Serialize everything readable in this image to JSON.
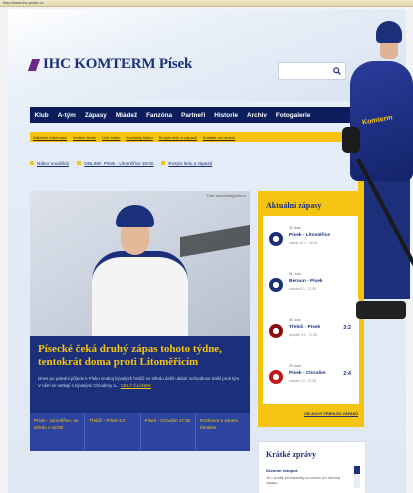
{
  "window": {
    "title": "http://www.ihc-pisek.cz"
  },
  "brand": {
    "name": "IHC KOMTERM Písek",
    "accent": "#1b2f7a",
    "yellow": "#f5c410"
  },
  "search": {
    "placeholder": "",
    "icon": "search-icon"
  },
  "nav": {
    "items": [
      "Klub",
      "A-tým",
      "Zápasy",
      "Mládež",
      "Fanzóna",
      "Partneři",
      "Historie",
      "Archiv",
      "Fotogalerie"
    ]
  },
  "subnav": {
    "items": [
      "Základní informace",
      "Vedení klubu",
      "Lidé klubu",
      "Kontakty klubu",
      "Rozpis ledu a zápasů",
      "Kontakt na vedení"
    ]
  },
  "ticker": {
    "items": [
      "Nábor nováčků!",
      "ONLINE: Písek - Litoměřice 18:00",
      "Rozpis ledu a zápasů"
    ]
  },
  "feature": {
    "credit": "Foto: www.hokejpisek.cz",
    "headline": "Písecké čeká druhý zápas tohoto týdne, tentokrát doma proti Litoměřicím",
    "lead": "Dnes po poledni přijede k Písku souboj bývalých hráčů ve středu další utkání rozhodnout další proti tým. V něm se setkají s bývalými Chrudimy a...",
    "more": "CELÝ ČLÁNEK",
    "bottom": [
      "Písek - Litoměřice, ve středu v 18:00",
      "Třebíč - Písek 3:2",
      "Písek - Chrudim 17:30",
      "Rozhovor s Janem Šimkem"
    ]
  },
  "matches": {
    "title": "Aktuální zápasy",
    "items": [
      {
        "tag": "32. kolo",
        "teams": "Písek - Litoměřice",
        "when": "středa 12.1., 18:00",
        "score": "",
        "badge": "#1b2f7a"
      },
      {
        "tag": "31. kolo",
        "teams": "Beroun - Písek",
        "when": "sobota 8.1., 17:30",
        "score": "",
        "badge": "#1b2f7a"
      },
      {
        "tag": "30. kolo",
        "teams": "Třebíč - Písek",
        "when": "pondělí 3.1., 17:30",
        "score": "3:2",
        "badge": "#8a1010"
      },
      {
        "tag": "29. kolo",
        "teams": "Písek - Chrudim",
        "when": "sobota 1.1., 17:30",
        "score": "2:4",
        "badge": "#c01818"
      }
    ],
    "all_label": "CELKOVÝ PŘEHLED ZÁPASŮ"
  },
  "news": {
    "title": "Krátké zprávy",
    "item_title": "Sezónní vstupné",
    "item_desc": "Již v prodeji permanentky na sezónu pro všechny zápasy..."
  }
}
